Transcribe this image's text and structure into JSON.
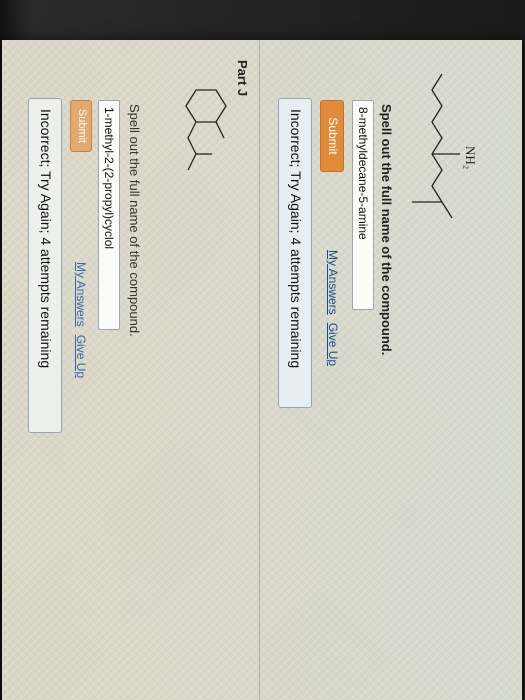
{
  "part_i": {
    "amine_label": "NH₂",
    "prompt": "Spell out the full name of the compound.",
    "answer_value": "8-methyldecane-5-amine",
    "submit_label": "Submit",
    "my_answers_label": "My Answers",
    "give_up_label": "Give Up",
    "feedback": "Incorrect; Try Again; 4 attempts remaining"
  },
  "part_j": {
    "title": "Part J",
    "prompt": "Spell out the full name of the compound.",
    "answer_value": "1-methyl-2-(2-propyl)cyclol",
    "submit_label": "Submit",
    "my_answers_label": "My Answers",
    "give_up_label": "Give Up",
    "feedback": "Incorrect; Try Again; 4 attempts remaining"
  },
  "colors": {
    "submit": "#e08a3c",
    "link": "#1b4b8e",
    "feedback_bg": "#e8edf3"
  }
}
